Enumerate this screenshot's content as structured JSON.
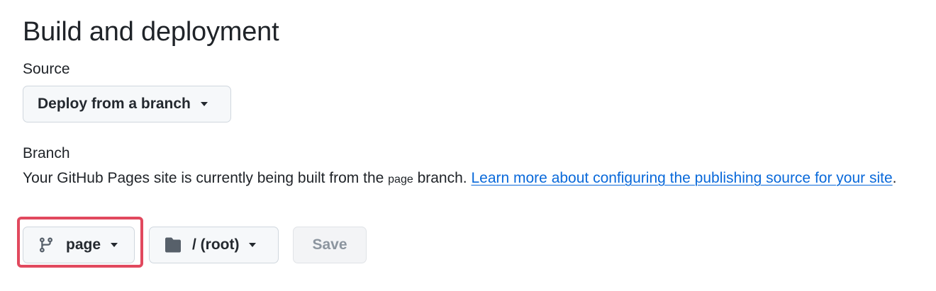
{
  "header": {
    "title": "Build and deployment"
  },
  "source": {
    "label": "Source",
    "dropdown_value": "Deploy from a branch"
  },
  "branch": {
    "label": "Branch",
    "description_prefix": "Your GitHub Pages site is currently being built from the ",
    "branch_code": "page",
    "description_suffix": " branch. ",
    "learn_more_link": "Learn more about configuring the publishing source for your site",
    "description_end": ".",
    "branch_dropdown_value": "page",
    "folder_dropdown_value": "/ (root)",
    "save_label": "Save"
  },
  "icons": {
    "branch": "git-branch-icon",
    "folder": "folder-icon",
    "caret": "triangle-down-icon"
  },
  "colors": {
    "link": "#0969da",
    "highlight_border": "#e1495e",
    "button_bg": "#f6f8fa",
    "disabled_text": "#8c959f"
  }
}
